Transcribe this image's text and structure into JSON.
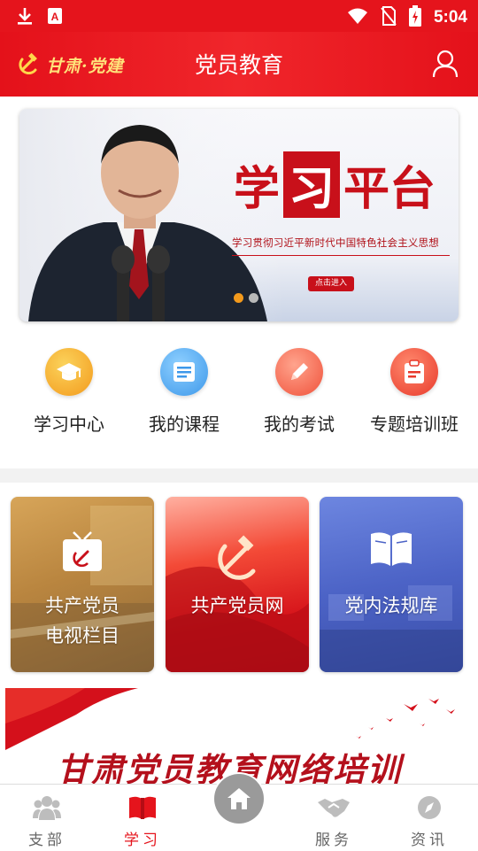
{
  "status_bar": {
    "time": "5:04",
    "icons": [
      "download-icon",
      "a-badge-icon",
      "wifi-icon",
      "no-sim-icon",
      "battery-charging-icon"
    ]
  },
  "header": {
    "logo_text": "甘肃·党建",
    "title": "党员教育",
    "user_icon": "user-icon"
  },
  "banner": {
    "title_part1": "学",
    "title_part2": "习",
    "title_part3": "平台",
    "subtitle": "学习贯彻习近平新时代中国特色社会主义思想",
    "button_label": "点击进入",
    "active_slide": 1,
    "slide_count": 2
  },
  "quick_menu": {
    "items": [
      {
        "label": "学习中心",
        "icon": "graduation-cap-icon",
        "color": "#f5a623"
      },
      {
        "label": "我的课程",
        "icon": "course-list-icon",
        "color": "#4aa3f0"
      },
      {
        "label": "我的考试",
        "icon": "pencil-icon",
        "color": "#f4624a"
      },
      {
        "label": "专题培训班",
        "icon": "clipboard-icon",
        "color": "#f04a3a"
      }
    ]
  },
  "cards": [
    {
      "label": "共产党员电视栏目",
      "icon": "tv-party-icon"
    },
    {
      "label": "共产党员网",
      "icon": "party-emblem-icon"
    },
    {
      "label": "党内法规库",
      "icon": "book-icon"
    }
  ],
  "bottom_banner": {
    "text": "甘肃党员教育网络培训"
  },
  "bottom_nav": {
    "items": [
      {
        "label": "支部",
        "icon": "people-icon"
      },
      {
        "label": "学习",
        "icon": "book-open-icon"
      },
      {
        "label": "服务",
        "icon": "handshake-icon"
      },
      {
        "label": "资讯",
        "icon": "compass-icon"
      }
    ],
    "home_icon": "home-icon",
    "active": "学习"
  },
  "colors": {
    "primary_red": "#e5141c",
    "active_nav": "#e5141c",
    "accent_gold": "#ffe27a"
  }
}
